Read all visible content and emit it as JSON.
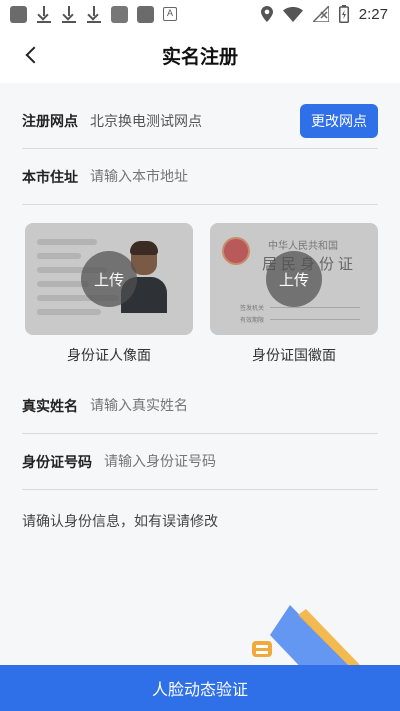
{
  "status_bar": {
    "time": "2:27",
    "notification_icons": [
      "app-icon",
      "download-icon",
      "download-icon",
      "download-icon",
      "cat-app-icon",
      "app-icon",
      "a-icon"
    ],
    "system_icons": [
      "location-icon",
      "wifi-icon",
      "no-signal-icon",
      "battery-charging-icon"
    ]
  },
  "header": {
    "title": "实名注册"
  },
  "form": {
    "outlet": {
      "label": "注册网点",
      "value": "北京换电测试网点",
      "change_button": "更改网点"
    },
    "address": {
      "label": "本市住址",
      "placeholder": "请输入本市地址"
    },
    "name": {
      "label": "真实姓名",
      "placeholder": "请输入真实姓名"
    },
    "id_number": {
      "label": "身份证号码",
      "placeholder": "请输入身份证号码"
    }
  },
  "id_cards": {
    "front": {
      "upload_label": "上传",
      "caption": "身份证人像面"
    },
    "back": {
      "upload_label": "上传",
      "caption": "身份证国徽面",
      "card_text_line1": "中华人民共和国",
      "card_text_line2": "居民身份证",
      "card_small_1": "签发机关",
      "card_small_2": "有效期限"
    }
  },
  "notice": "请确认身份信息，如有误请修改",
  "bottom_button": "人脸动态验证",
  "colors": {
    "primary": "#2f6fe8",
    "background": "#f6f7f9"
  }
}
